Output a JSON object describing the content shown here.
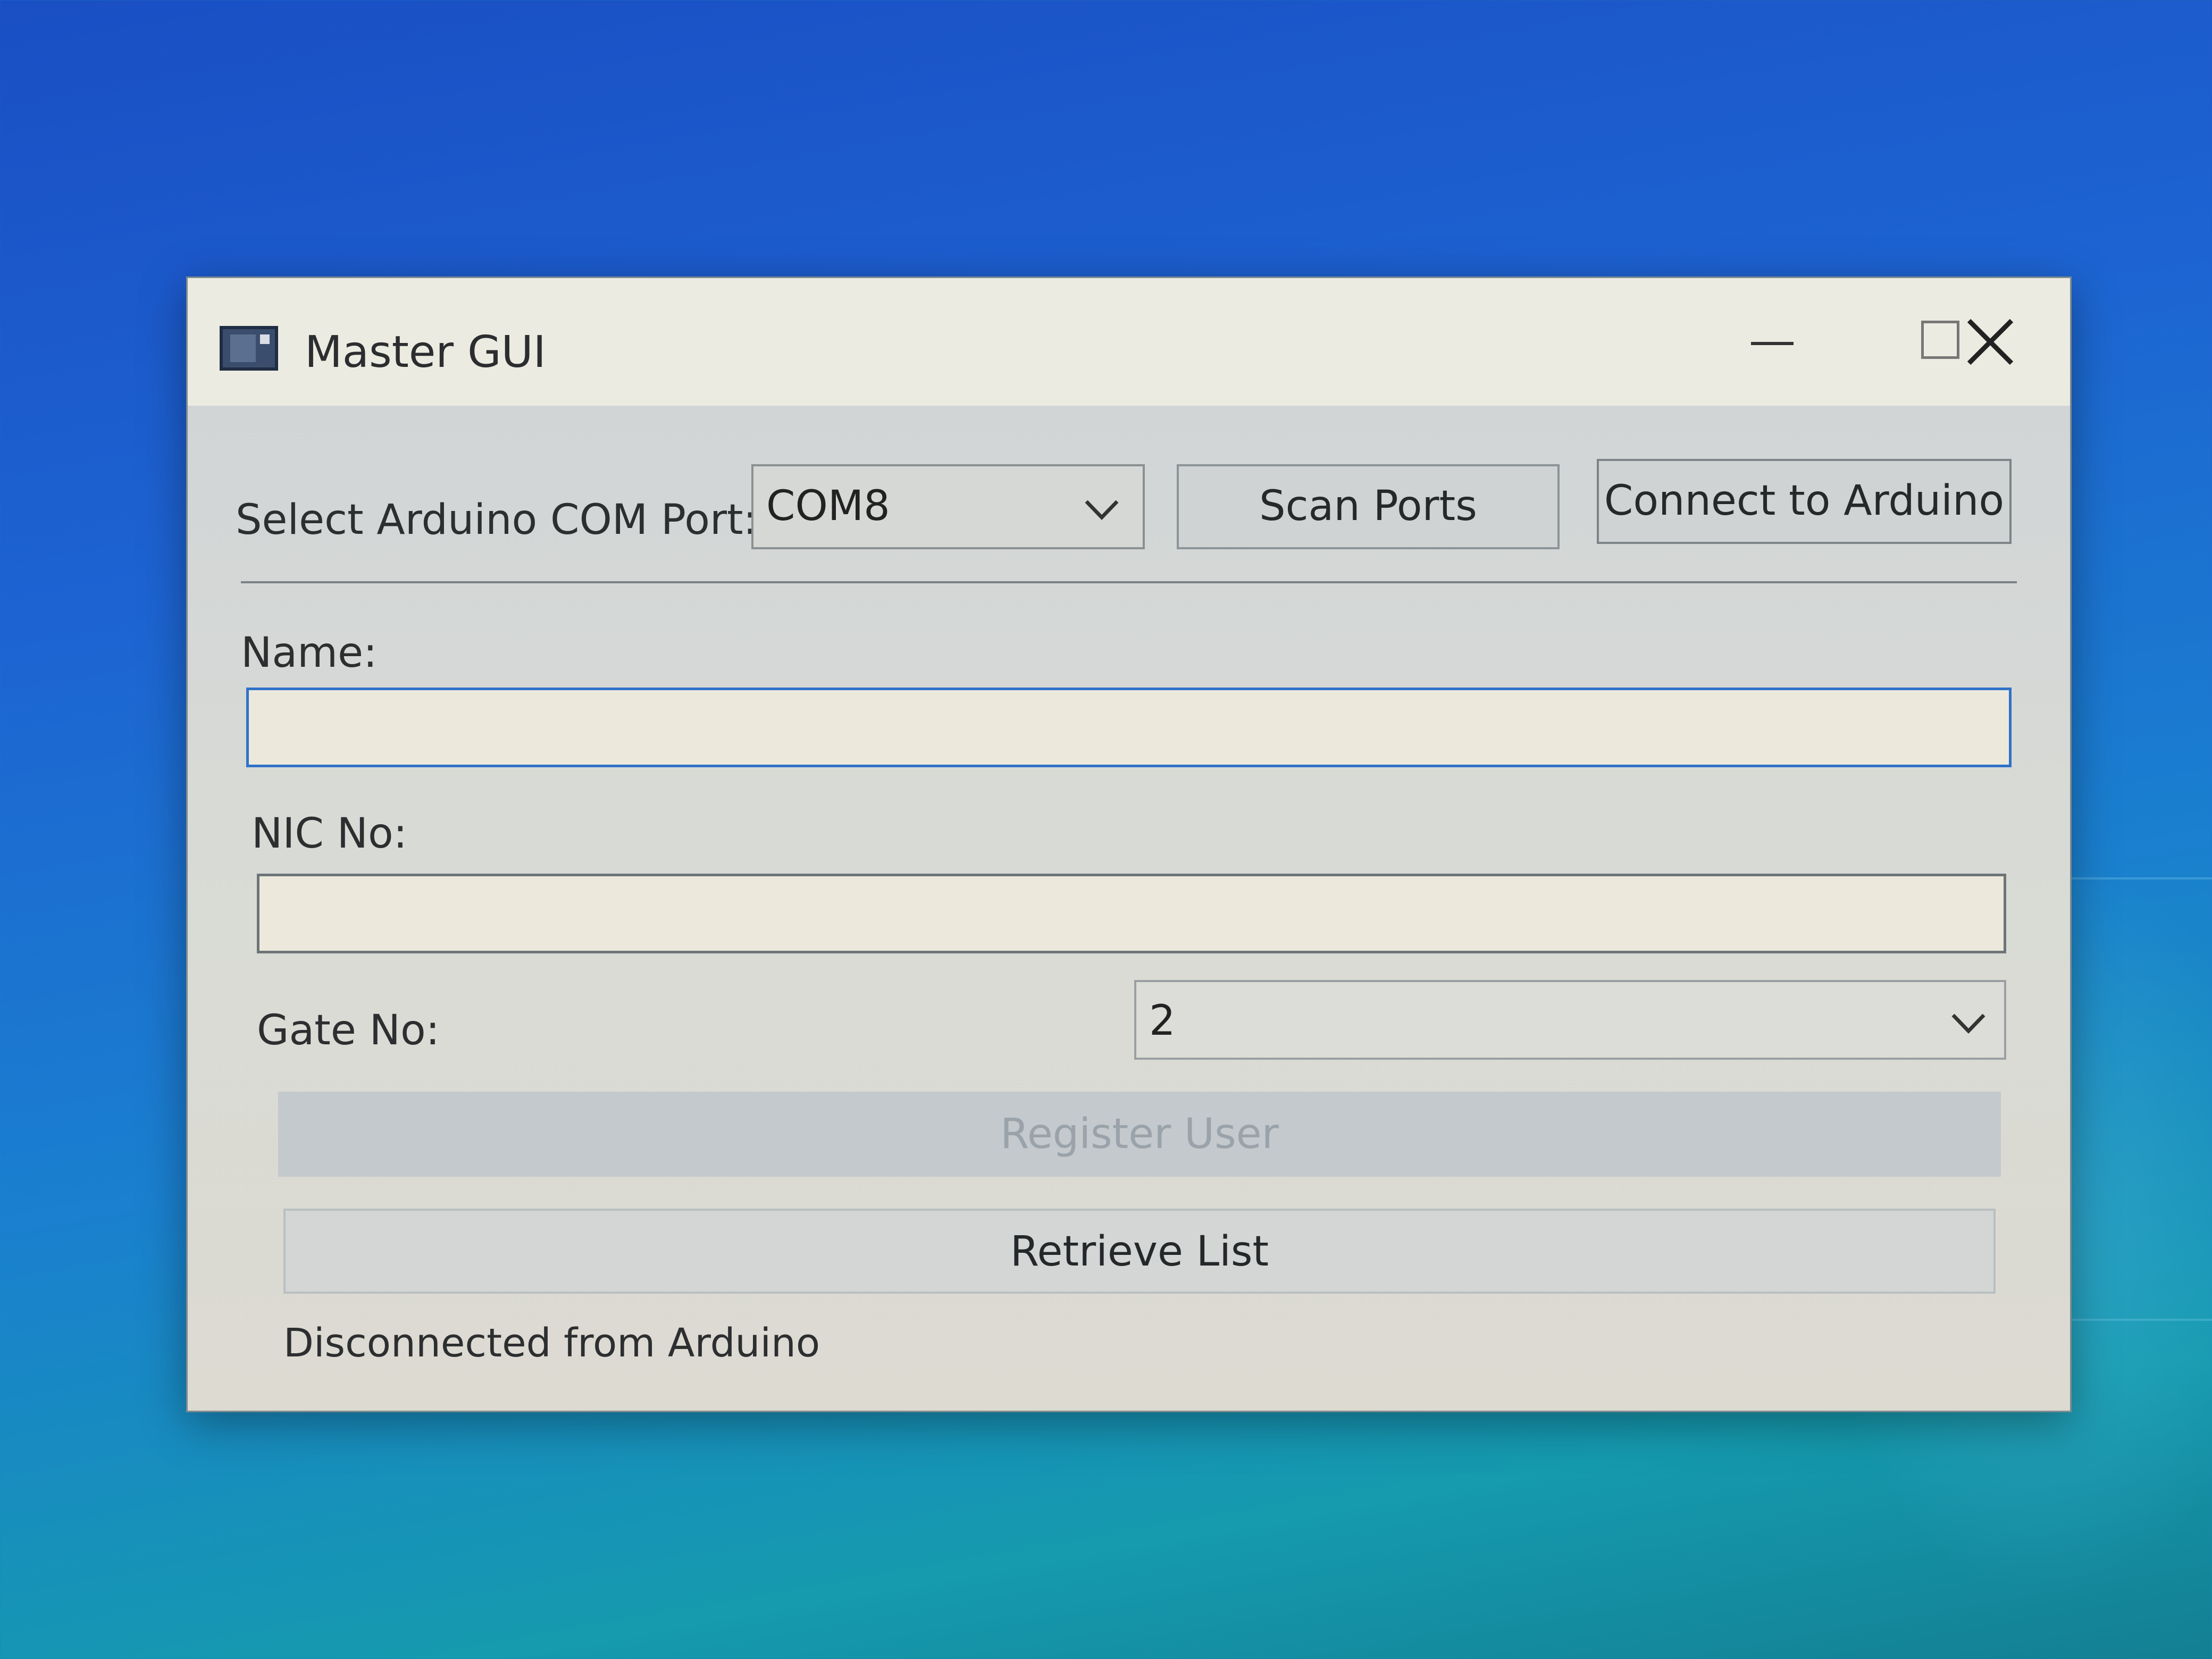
{
  "window": {
    "title": "Master GUI"
  },
  "titlebar": {
    "minimize_icon": "minimize-icon",
    "maximize_icon": "maximize-icon",
    "close_icon": "close-icon"
  },
  "port_row": {
    "label": "Select Arduino COM Port:",
    "port_value": "COM8",
    "scan_button": "Scan Ports",
    "connect_button": "Connect to Arduino"
  },
  "form": {
    "name_label": "Name:",
    "name_value": "",
    "nic_label": "NIC No:",
    "nic_value": "",
    "gate_label": "Gate No:",
    "gate_value": "2"
  },
  "actions": {
    "register_button": "Register User",
    "retrieve_button": "Retrieve List"
  },
  "status": {
    "text": "Disconnected from Arduino"
  },
  "colors": {
    "focus_border": "#2f72c9",
    "disabled_text": "#9aa3aa",
    "desktop_blue": "#1d63d2"
  }
}
